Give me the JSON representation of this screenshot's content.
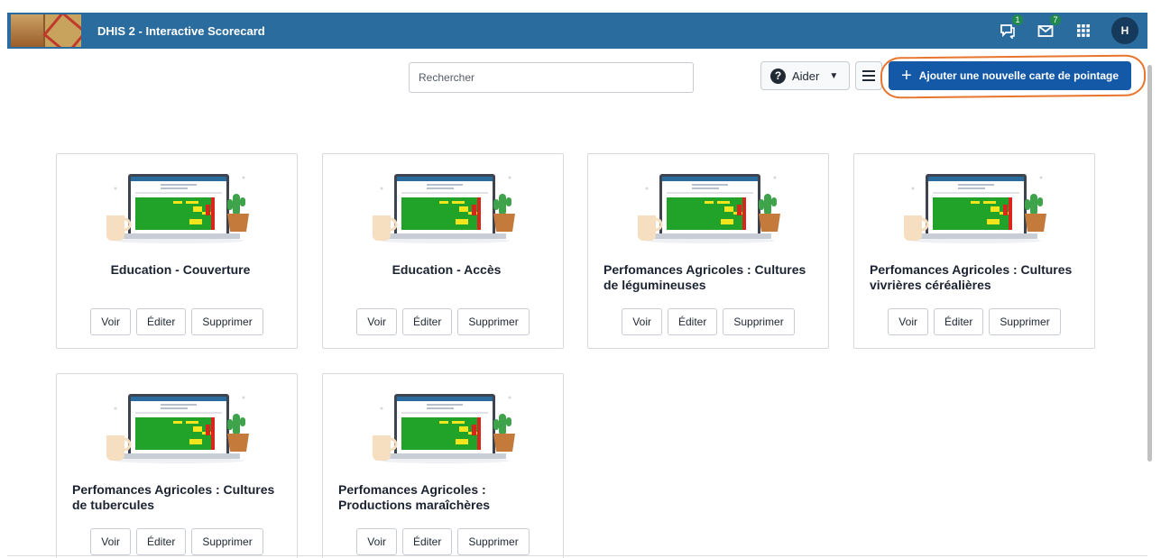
{
  "header": {
    "app_title": "DHIS 2 - Interactive Scorecard",
    "interpretations_badge": "1",
    "messages_badge": "7",
    "avatar_initial": "H",
    "bg_color": "#2b6c9e"
  },
  "toolbar": {
    "search_placeholder": "Rechercher",
    "help_label": "Aider",
    "add_label": "Ajouter une nouvelle carte de pointage",
    "accent_color": "#1458a8"
  },
  "cards": [
    {
      "title": "Education - Couverture",
      "view": "Voir",
      "edit": "Éditer",
      "delete": "Supprimer"
    },
    {
      "title": "Education - Accès",
      "view": "Voir",
      "edit": "Éditer",
      "delete": "Supprimer"
    },
    {
      "title": "Perfomances Agricoles : Cultures de légumineuses",
      "view": "Voir",
      "edit": "Éditer",
      "delete": "Supprimer"
    },
    {
      "title": "Perfomances Agricoles : Cultures vivrières céréalières",
      "view": "Voir",
      "edit": "Éditer",
      "delete": "Supprimer"
    },
    {
      "title": "Perfomances Agricoles : Cultures de tubercules",
      "view": "Voir",
      "edit": "Éditer",
      "delete": "Supprimer"
    },
    {
      "title": "Perfomances Agricoles : Productions maraîchères",
      "view": "Voir",
      "edit": "Éditer",
      "delete": "Supprimer"
    }
  ],
  "annotation_color": "#e8752e"
}
